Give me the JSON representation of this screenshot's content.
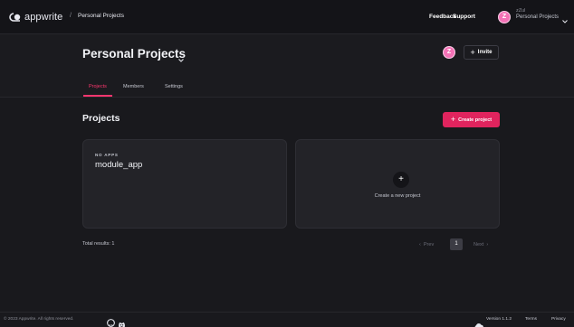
{
  "brand": {
    "logo_text": "appwrite"
  },
  "breadcrumb": {
    "separator": "/",
    "current": "Personal Projects"
  },
  "topnav": {
    "feedback": "Feedback",
    "support": "Support"
  },
  "account": {
    "avatar_initial": "Z",
    "name": "zZul",
    "project": "Personal Projects"
  },
  "header": {
    "title": "Personal Projects",
    "avatar_initial": "Z",
    "invite_label": "Invite",
    "invite_icon": "plus-icon",
    "tabs": [
      {
        "label": "Projects",
        "active": true
      },
      {
        "label": "Members",
        "active": false
      },
      {
        "label": "Settings",
        "active": false
      }
    ]
  },
  "main": {
    "section_title": "Projects",
    "create_label": "Create project",
    "create_icon": "plus-icon",
    "projects": [
      {
        "apps_label": "NO APPS",
        "name": "module_app"
      }
    ],
    "new_project_label": "Create a new project",
    "total_results": "Total results: 1",
    "pagination": {
      "prev": "Prev",
      "current_page": "1",
      "next": "Next"
    }
  },
  "footer": {
    "copyright": "© 2023 Appwrite. All rights reserved.",
    "version": "Version 1.1.2",
    "terms": "Terms",
    "privacy": "Privacy"
  },
  "colors": {
    "accent": "#fd366e",
    "primary_button": "#e0245e",
    "avatar": "#f472b6",
    "background": "#19191d",
    "card": "#232328"
  }
}
